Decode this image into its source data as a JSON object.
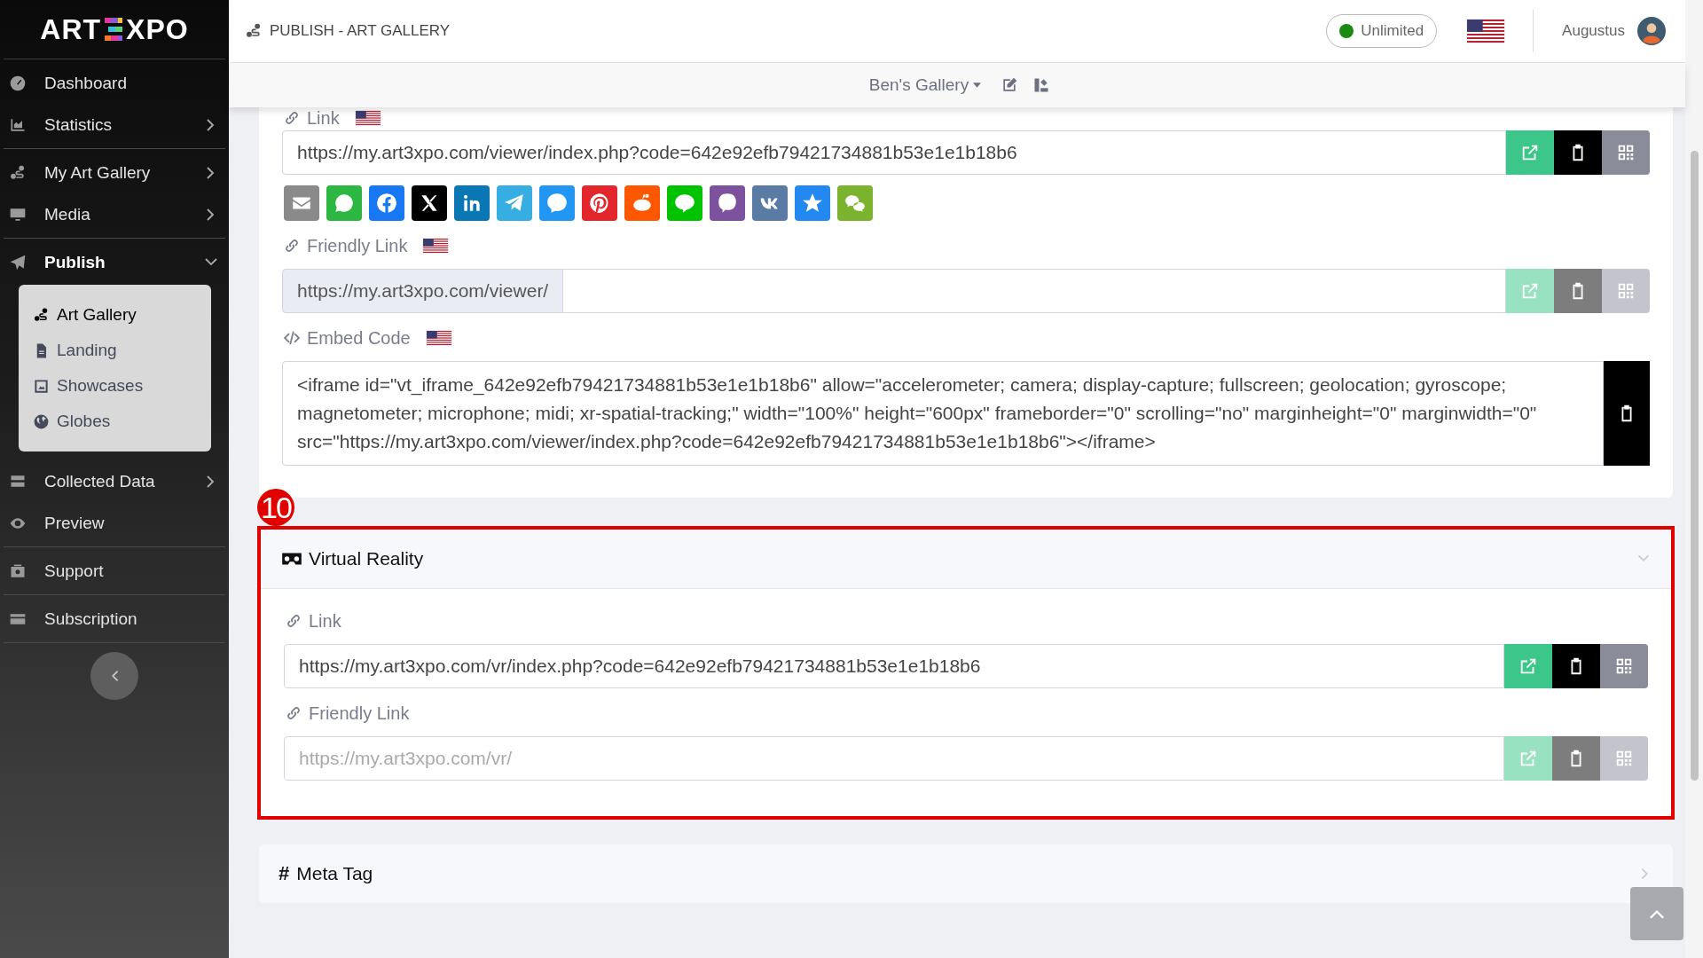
{
  "sidebar": {
    "logo": {
      "left": "ART",
      "right": "XPO"
    },
    "groups": [
      {
        "items": [
          {
            "label": "Dashboard"
          },
          {
            "label": "Statistics",
            "expanded": false
          }
        ]
      },
      {
        "items": [
          {
            "label": "My Art Gallery",
            "expanded": false
          },
          {
            "label": "Media",
            "expanded": false
          }
        ]
      },
      {
        "items": [
          {
            "label": "Publish",
            "expanded": true,
            "children": [
              {
                "label": "Art Gallery",
                "selected": true
              },
              {
                "label": "Landing",
                "selected": false
              },
              {
                "label": "Showcases",
                "selected": false
              },
              {
                "label": "Globes",
                "selected": false
              }
            ]
          },
          {
            "label": "Collected Data",
            "expanded": false
          },
          {
            "label": "Preview"
          }
        ]
      },
      {
        "items": [
          {
            "label": "Support"
          }
        ]
      },
      {
        "items": [
          {
            "label": "Subscription"
          }
        ]
      }
    ]
  },
  "header": {
    "title": "PUBLISH - ART GALLERY",
    "plan": "Unlimited",
    "user": "Augustus"
  },
  "toolbar": {
    "gallery": "Ben's Gallery"
  },
  "sections": [
    {
      "fields": [
        {
          "kind": "link",
          "label": "Link",
          "flag": true,
          "value": "https://my.art3xpo.com/viewer/index.php?code=642e92efb79421734881b53e1e1b18b6",
          "actions_disabled": false
        },
        {
          "kind": "share",
          "buttons": [
            {
              "color": "#8a8a8a"
            },
            {
              "color": "#2cb742"
            },
            {
              "color": "#1877f2"
            },
            {
              "color": "#000000"
            },
            {
              "color": "#0a77b5"
            },
            {
              "color": "#37aee2"
            },
            {
              "color": "#2196f3"
            },
            {
              "color": "#e3262c"
            },
            {
              "color": "#ff5700"
            },
            {
              "color": "#00c300"
            },
            {
              "color": "#7c529e"
            },
            {
              "color": "#5a7ba3"
            },
            {
              "color": "#2389f0"
            },
            {
              "color": "#7bb32e"
            }
          ]
        },
        {
          "kind": "link",
          "label": "Friendly Link",
          "flag": true,
          "prefix": "https://my.art3xpo.com/viewer/",
          "actions_disabled": true
        },
        {
          "kind": "embed",
          "label": "Embed Code",
          "flag": true,
          "value": "<iframe id=\"vt_iframe_642e92efb79421734881b53e1e1b18b6\" allow=\"accelerometer; camera; display-capture; fullscreen; geolocation; gyroscope; magnetometer; microphone; midi; xr-spatial-tracking;\" width=\"100%\" height=\"600px\" frameborder=\"0\" scrolling=\"no\" marginheight=\"0\" marginwidth=\"0\" src=\"https://my.art3xpo.com/viewer/index.php?code=642e92efb79421734881b53e1e1b18b6\"></iframe>"
        }
      ]
    },
    {
      "title": "Virtual Reality",
      "expanded": true,
      "highlighted": true,
      "badge": "10",
      "fields": [
        {
          "kind": "link",
          "label": "Link",
          "value": "https://my.art3xpo.com/vr/index.php?code=642e92efb79421734881b53e1e1b18b6",
          "actions_disabled": false
        },
        {
          "kind": "link",
          "label": "Friendly Link",
          "placeholder": "https://my.art3xpo.com/vr/",
          "actions_disabled": true
        }
      ]
    },
    {
      "title": "Meta Tag",
      "icon_text": "#",
      "expanded": false,
      "highlighted": false
    }
  ]
}
